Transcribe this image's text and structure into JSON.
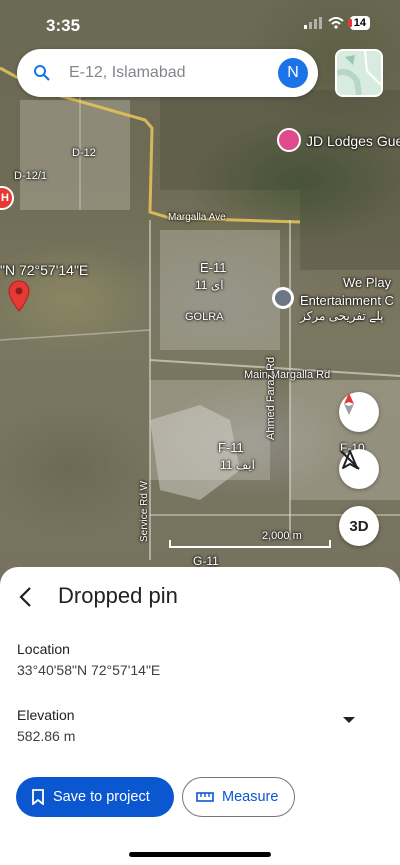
{
  "status_bar": {
    "time": "3:35",
    "battery": "14"
  },
  "search": {
    "query": "E-12, Islamabad",
    "avatar_letter": "N"
  },
  "map": {
    "labels": {
      "d12": "D-12",
      "d121": "D-12/1",
      "jd_lodges": "JD Lodges Gue",
      "margalla_ave": "Margalla Ave",
      "e11": "E-11",
      "e11_urdu": "ای 11",
      "golra": "GOLRA",
      "we_play": "We Play",
      "entertainment": "Entertainment C",
      "urdu_play": "پلے تفریحی مرکز",
      "coord_partial": "\"N 72°57'14\"E",
      "main_margalla": "Main Margalla Rd",
      "ahmed_faraz": "Ahmed Faraz Rd",
      "f11": "F-11",
      "f11_urdu": "ایف 11",
      "f10": "F-10",
      "service_rd": "Service Rd W",
      "scale": "2,000 m",
      "g11": "G-11"
    },
    "buttons": {
      "threed": "3D"
    }
  },
  "sheet": {
    "title": "Dropped pin",
    "location_label": "Location",
    "location_value": "33°40'58\"N 72°57'14\"E",
    "elevation_label": "Elevation",
    "elevation_value": "582.86 m",
    "save_label": "Save to project",
    "measure_label": "Measure"
  },
  "colors": {
    "primary": "#0b57d0",
    "poi_pink": "#e04a8b",
    "pin_red": "#e53935"
  }
}
